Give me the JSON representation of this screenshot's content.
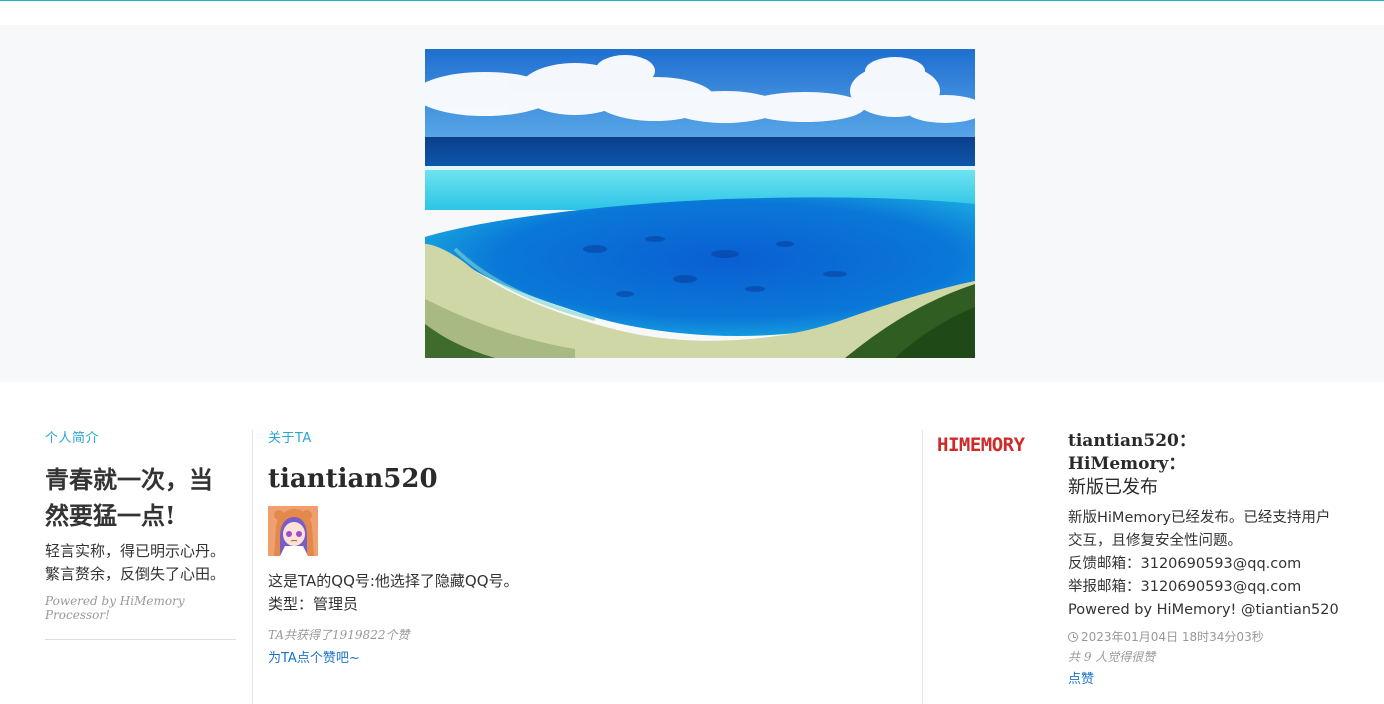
{
  "colors": {
    "accent": "#2aa6cf",
    "link": "#1a73c8",
    "muted": "#999999",
    "brand_red": "#d02b2b"
  },
  "profile": {
    "section_label": "个人简介",
    "motto_line1": "青春就一次，当",
    "motto_line2": "然要猛一点!",
    "desc_line1": "轻言实称，得已明示心丹。",
    "desc_line2": "繁言赘余，反倒失了心田。",
    "powered_by": "Powered by HiMemory Processor!"
  },
  "about": {
    "section_label": "关于TA",
    "username": "tiantian520",
    "qq_text": "这是TA的QQ号:他选择了隐藏QQ号。",
    "type_text": "类型：管理员",
    "likes_text": "TA共获得了1919822个赞",
    "like_link": "为TA点个赞吧~"
  },
  "post": {
    "logo_text": "HIMEMORY",
    "title_line1": "tiantian520：",
    "title_line2": "HiMemory：",
    "title_line3": "新版已发布",
    "body_line1": "新版HiMemory已经发布。已经支持用户",
    "body_line2": "交互，且修复安全性问题。",
    "body_line3": "反馈邮箱：3120690593@qq.com",
    "body_line4": "举报邮箱：3120690593@qq.com",
    "body_line5": "Powered by HiMemory! @tiantian520",
    "date": "2023年01月04日 18时34分03秒",
    "likes": "共 9 人觉得很赞",
    "like_button": "点赞",
    "icons": {
      "date": "clock-icon"
    }
  }
}
